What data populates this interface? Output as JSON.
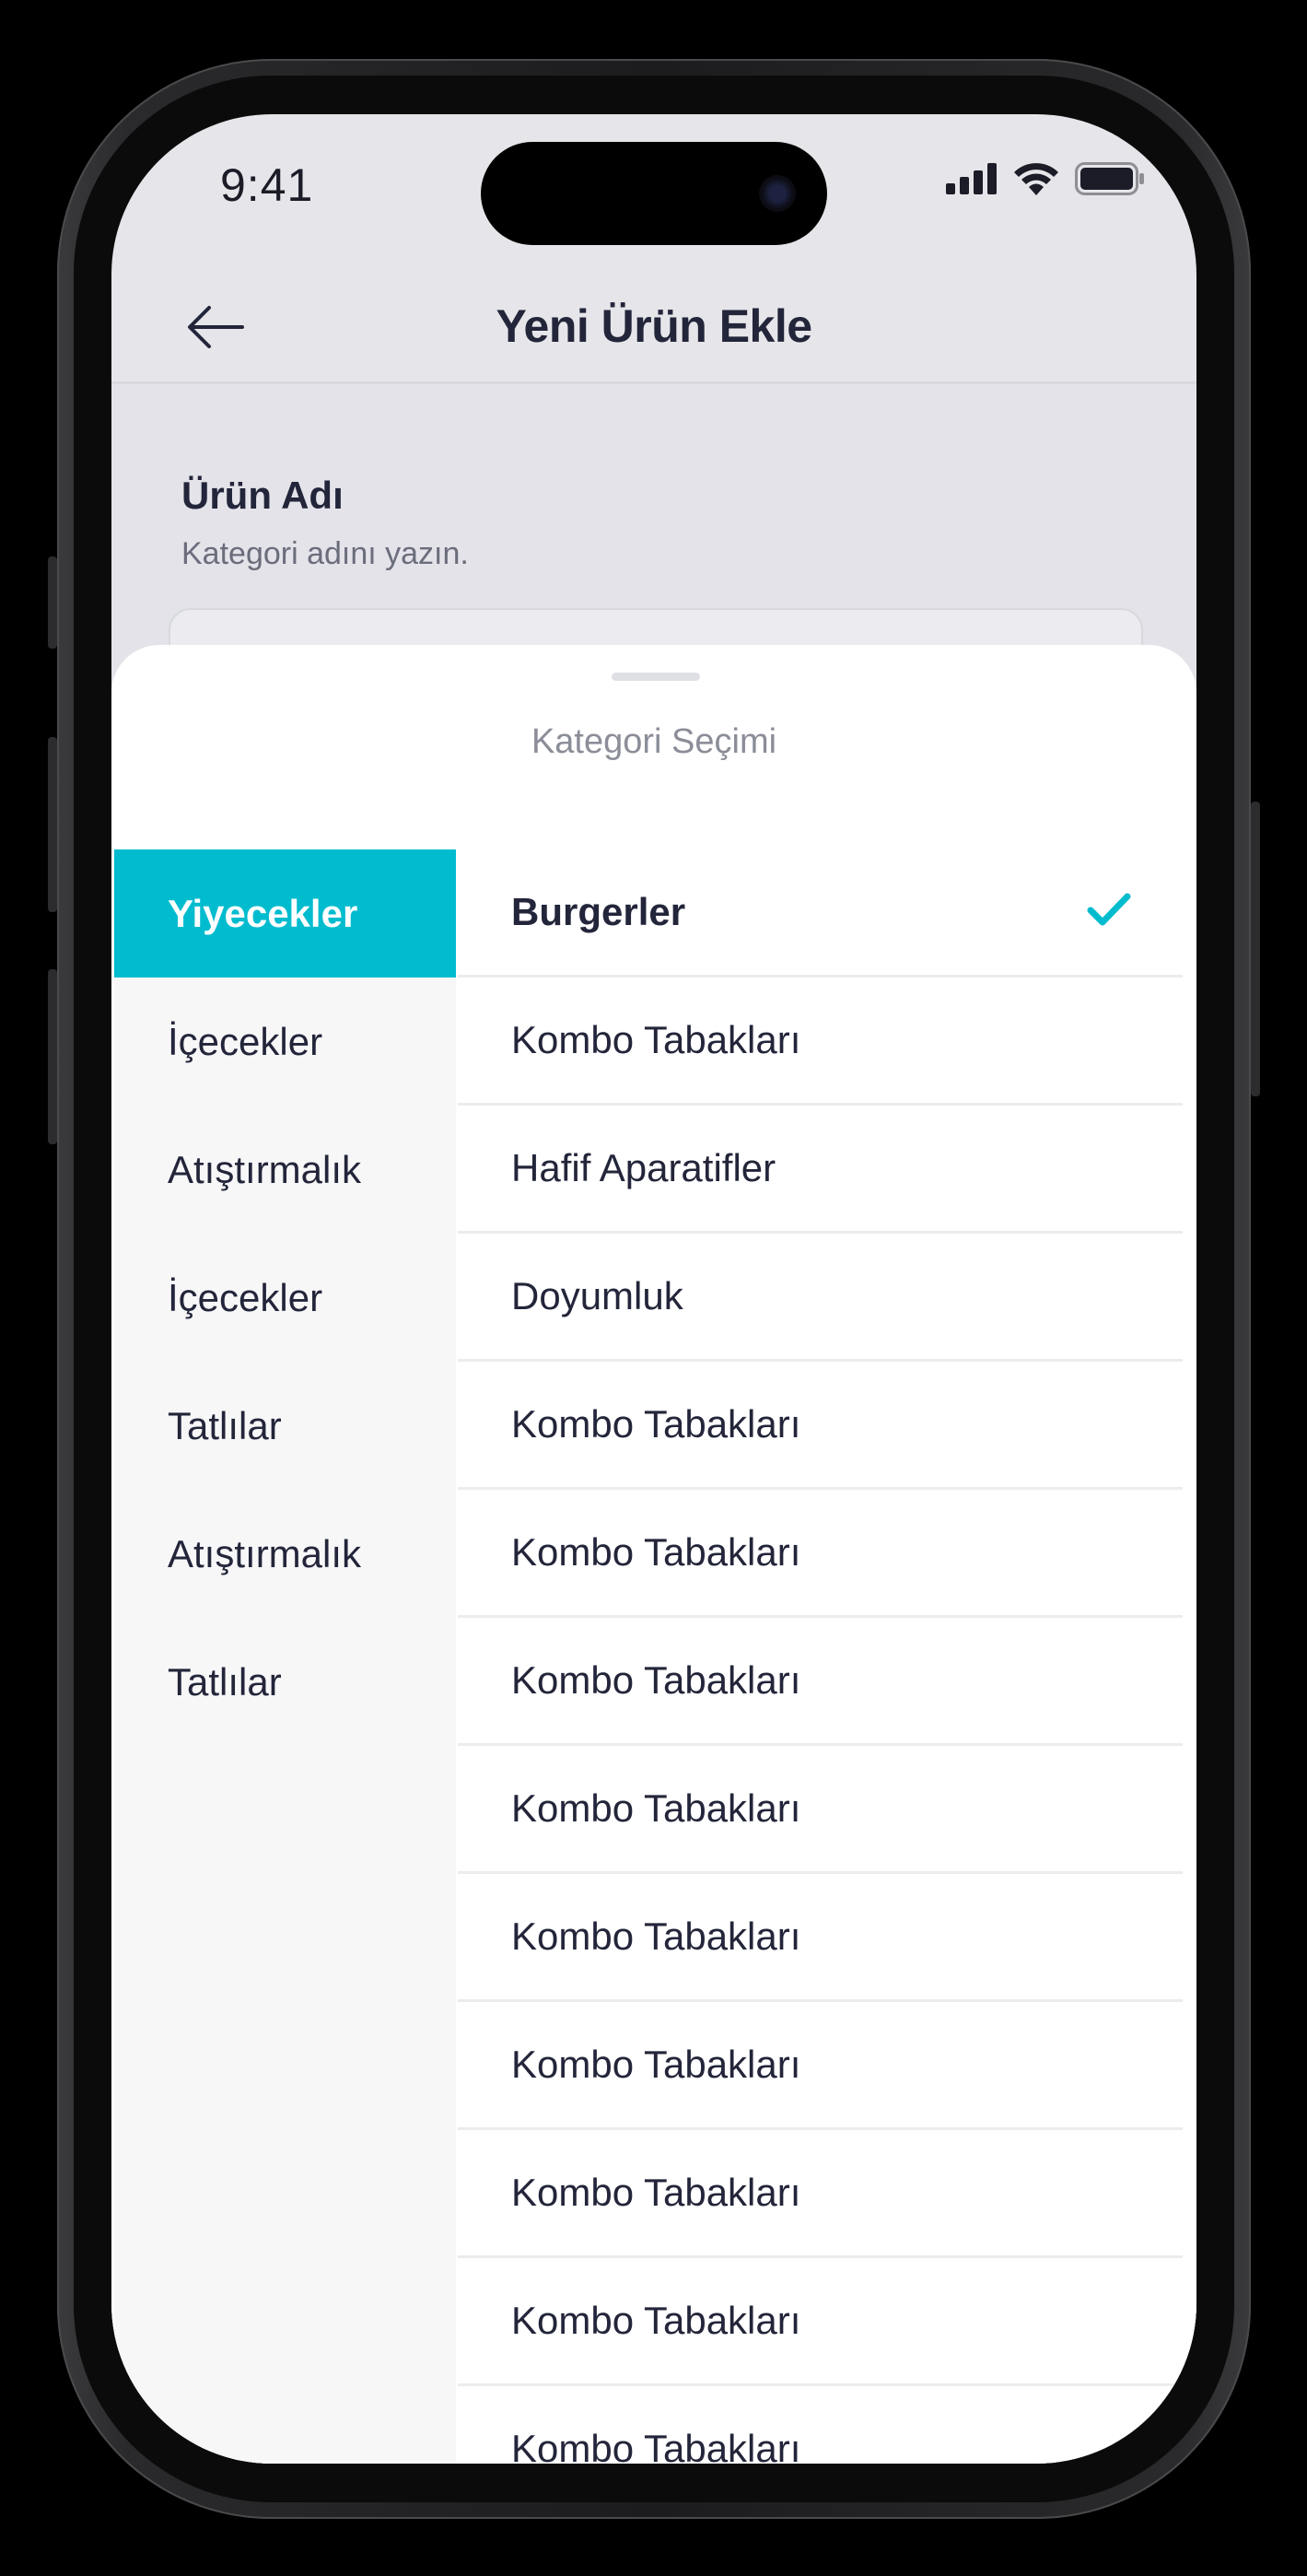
{
  "status_bar": {
    "time": "9:41"
  },
  "header": {
    "title": "Yeni Ürün Ekle"
  },
  "form": {
    "label": "Ürün Adı",
    "hint": "Kategori adını yazın."
  },
  "sheet": {
    "title": "Kategori Seçimi",
    "categories": [
      "Yiyecekler",
      "İçecekler",
      "Atıştırmalık",
      "İçecekler",
      "Tatlılar",
      "Atıştırmalık",
      "Tatlılar"
    ],
    "active_category": "Yiyecekler",
    "subcategories": [
      "Burgerler",
      "Kombo Tabakları",
      "Hafif Aparatifler",
      "Doyumluk",
      "Kombo Tabakları",
      "Kombo Tabakları",
      "Kombo Tabakları",
      "Kombo Tabakları",
      "Kombo Tabakları",
      "Kombo Tabakları",
      "Kombo Tabakları",
      "Kombo Tabakları",
      "Kombo Tabakları"
    ],
    "selected_subcategory": "Burgerler"
  },
  "colors": {
    "accent": "#00bcce",
    "text_primary": "#23253a",
    "text_muted": "#8b8d98"
  },
  "icons": {
    "back": "arrow-left-icon",
    "check": "check-icon",
    "signal": "cellular-signal-icon",
    "wifi": "wifi-icon",
    "battery": "battery-icon"
  }
}
